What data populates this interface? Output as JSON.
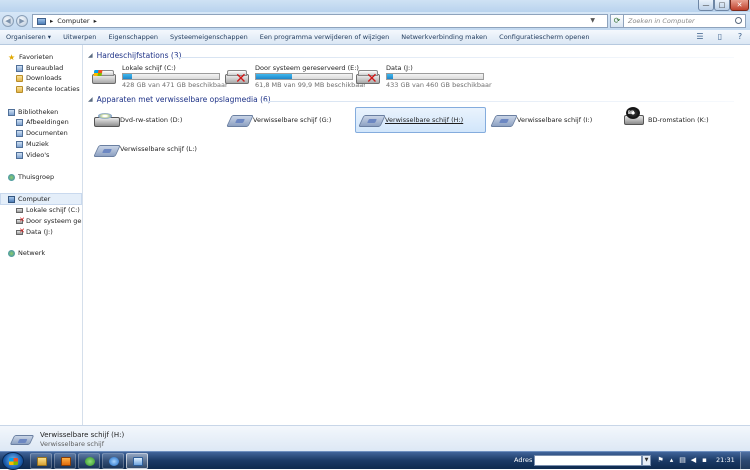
{
  "window": {
    "buttons": {
      "minimize": "—",
      "maximize": "□",
      "close": "✕"
    }
  },
  "address": {
    "path": "Computer",
    "search_placeholder": "Zoeken in Computer"
  },
  "toolbar": {
    "items": [
      "Organiseren ▾",
      "Uitwerpen",
      "Eigenschappen",
      "Systeemeigenschappen",
      "Een programma verwijderen of wijzigen",
      "Netwerkverbinding maken",
      "Configuratiescherm openen"
    ]
  },
  "nav": {
    "favorites": {
      "label": "Favorieten",
      "items": [
        "Bureaublad",
        "Downloads",
        "Recente locaties"
      ]
    },
    "libraries": {
      "label": "Bibliotheken",
      "items": [
        "Afbeeldingen",
        "Documenten",
        "Muziek",
        "Video's"
      ]
    },
    "homegroup": "Thuisgroep",
    "computer": {
      "label": "Computer",
      "items": [
        "Lokale schijf (C:)",
        "Door systeem gereserveerd (E:)",
        "Data (J:)"
      ]
    },
    "network": "Netwerk"
  },
  "groups": {
    "hdd_header": "Hardeschijfstations (3)",
    "removable_header": "Apparaten met verwisselbare opslagmedia (6)"
  },
  "drives": [
    {
      "name": "Lokale schijf (C:)",
      "free": "428 GB van 471 GB beschikbaar",
      "used_fraction": 0.09,
      "icon": "hdd-windows-icon"
    },
    {
      "name": "Door systeem gereserveerd (E:)",
      "free": "61,8 MB van 99,9 MB beschikbaar",
      "used_fraction": 0.38,
      "icon": "hdd-error-icon"
    },
    {
      "name": "Data (J:)",
      "free": "433 GB van 460 GB beschikbaar",
      "used_fraction": 0.06,
      "icon": "hdd-error-icon"
    }
  ],
  "removable": [
    {
      "name": "Dvd-rw-station (D:)",
      "icon": "dvd-drive-icon"
    },
    {
      "name": "Verwisselbare schijf (G:)",
      "icon": "removable-disk-icon"
    },
    {
      "name": "Verwisselbare schijf (H:)",
      "icon": "removable-disk-icon",
      "selected": true
    },
    {
      "name": "Verwisselbare schijf (I:)",
      "icon": "removable-disk-icon"
    },
    {
      "name": "BD-romstation (K:)",
      "icon": "bd-drive-icon",
      "icon_text": "BD"
    },
    {
      "name": "Verwisselbare schijf (L:)",
      "icon": "removable-disk-icon"
    }
  ],
  "details": {
    "title": "Verwisselbare schijf (H:)",
    "subtitle": "Verwisselbare schijf"
  },
  "taskbar": {
    "address_label": "Adres",
    "clock": "21:31"
  },
  "colors": {
    "selection": "#d2e6fb",
    "capacity_bar": "#1f86c8",
    "group_header": "#1e3287",
    "taskbar": "#1b3a66"
  }
}
